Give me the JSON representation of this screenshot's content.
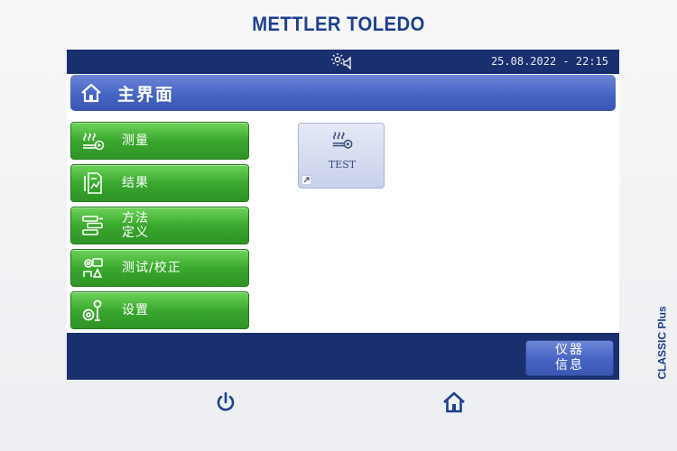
{
  "brand": "METTLER TOLEDO",
  "model": "CLASSIC Plus",
  "status": {
    "datetime": "25.08.2022 - 22:15",
    "icon": "display-brightness-speaker-icon"
  },
  "header": {
    "title": "主界面",
    "icon": "home-icon"
  },
  "menu": [
    {
      "line1": "测量",
      "line2": "",
      "icon": "measure-heat-icon"
    },
    {
      "line1": "结果",
      "line2": "",
      "icon": "results-document-icon"
    },
    {
      "line1": "方法",
      "line2": "定义",
      "icon": "method-definition-icon"
    },
    {
      "line1": "测试/校正",
      "line2": "",
      "icon": "test-adjust-icon"
    },
    {
      "line1": "设置",
      "line2": "",
      "icon": "settings-tools-icon"
    }
  ],
  "shortcut_tile": {
    "label": "TEST",
    "icon": "measure-heat-icon",
    "shortcut_icon": "shortcut-arrow-icon"
  },
  "bottom_bar": {
    "info_line1": "仪器",
    "info_line2": "信息"
  },
  "hardware_keys": {
    "power_icon": "power-icon",
    "home_icon": "home-icon"
  },
  "colors": {
    "bar_navy": "#1a2f6e",
    "header_blue": "#4564c4",
    "menu_green": "#3aa82f",
    "brand_blue": "#1f3f8f"
  }
}
